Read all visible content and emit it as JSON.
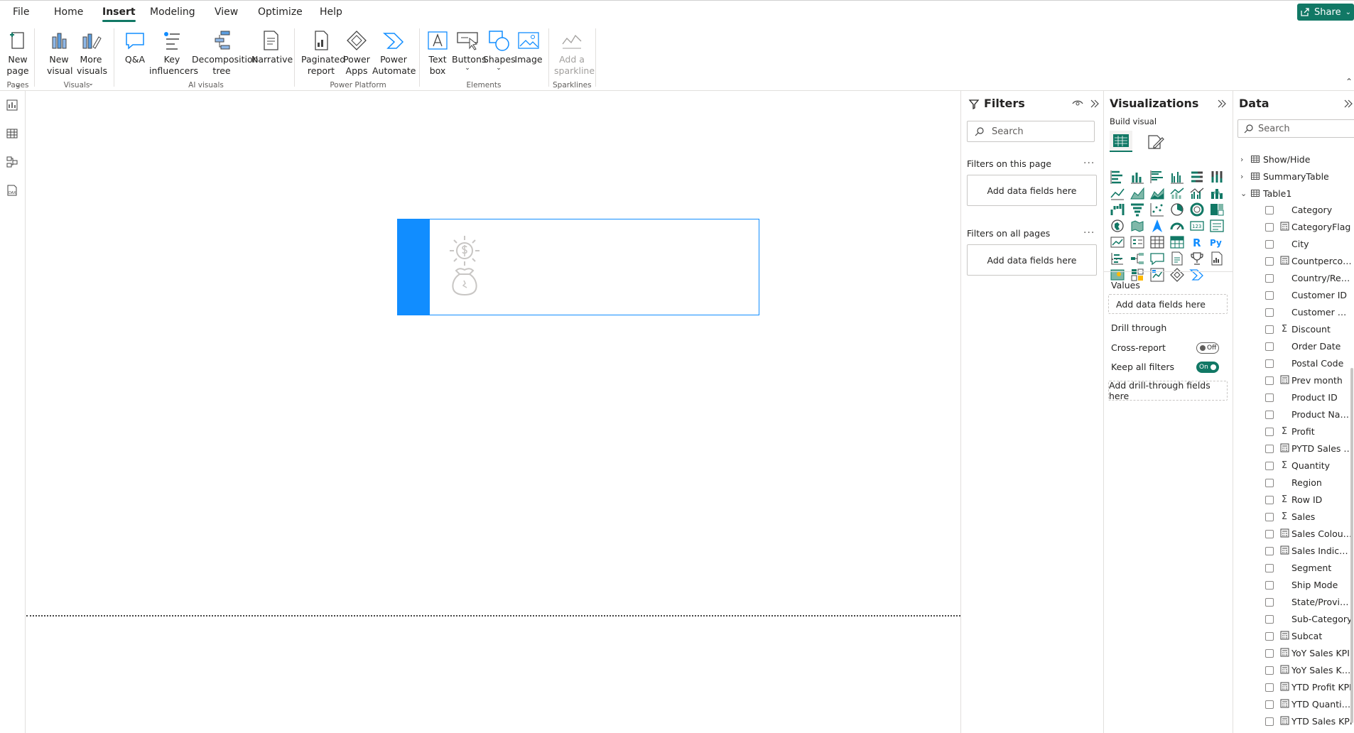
{
  "menu": {
    "file": "File",
    "home": "Home",
    "insert": "Insert",
    "modeling": "Modeling",
    "view": "View",
    "optimize": "Optimize",
    "help": "Help",
    "share": "Share"
  },
  "ribbon": {
    "new_page": [
      "New",
      "page"
    ],
    "new_visual": [
      "New",
      "visual"
    ],
    "more_visuals": [
      "More",
      "visuals"
    ],
    "qa": "Q&A",
    "key_influencers": [
      "Key",
      "influencers"
    ],
    "decomposition_tree": [
      "Decomposition",
      "tree"
    ],
    "narrative": "Narrative",
    "paginated_report": [
      "Paginated",
      "report"
    ],
    "power_apps": [
      "Power",
      "Apps"
    ],
    "power_automate": [
      "Power",
      "Automate"
    ],
    "text_box": [
      "Text",
      "box"
    ],
    "buttons": "Buttons",
    "shapes": "Shapes",
    "image": "Image",
    "add_sparkline": [
      "Add a",
      "sparkline"
    ],
    "groups": {
      "pages": "Pages",
      "visuals": "Visuals",
      "ai_visuals": "AI visuals",
      "power_platform": "Power Platform",
      "elements": "Elements",
      "sparklines": "Sparklines"
    }
  },
  "filters": {
    "title": "Filters",
    "search_placeholder": "Search",
    "on_this_page": "Filters on this page",
    "on_all_pages": "Filters on all pages",
    "add_fields": "Add data fields here",
    "more": "..."
  },
  "visualizations": {
    "title": "Visualizations",
    "build_visual": "Build visual",
    "values": "Values",
    "values_well": "Add data fields here",
    "drill_through": "Drill through",
    "cross_report": "Cross-report",
    "cross_report_state": "Off",
    "keep_all_filters": "Keep all filters",
    "keep_all_filters_state": "On",
    "drill_well": "Add drill-through fields here",
    "more": "...",
    "accent": "#117865"
  },
  "data": {
    "title": "Data",
    "search_placeholder": "Search",
    "tables": [
      "Show/Hide",
      "SummaryTable",
      "Table1"
    ],
    "fields": [
      {
        "name": "Category",
        "icon": ""
      },
      {
        "name": "CategoryFlag",
        "icon": "calc"
      },
      {
        "name": "City",
        "icon": ""
      },
      {
        "name": "Countpercount",
        "icon": "calc"
      },
      {
        "name": "Country/Region",
        "icon": ""
      },
      {
        "name": "Customer ID",
        "icon": ""
      },
      {
        "name": "Customer Na...",
        "icon": ""
      },
      {
        "name": "Discount",
        "icon": "sum"
      },
      {
        "name": "Order Date",
        "icon": ""
      },
      {
        "name": "Postal Code",
        "icon": ""
      },
      {
        "name": "Prev month",
        "icon": "calc"
      },
      {
        "name": "Product ID",
        "icon": ""
      },
      {
        "name": "Product Name",
        "icon": ""
      },
      {
        "name": "Profit",
        "icon": "sum"
      },
      {
        "name": "PYTD Sales KPI",
        "icon": "calc"
      },
      {
        "name": "Quantity",
        "icon": "sum"
      },
      {
        "name": "Region",
        "icon": ""
      },
      {
        "name": "Row ID",
        "icon": "sum"
      },
      {
        "name": "Sales",
        "icon": "sum"
      },
      {
        "name": "Sales Colour K...",
        "icon": "calc"
      },
      {
        "name": "Sales Indicato...",
        "icon": "calc"
      },
      {
        "name": "Segment",
        "icon": ""
      },
      {
        "name": "Ship Mode",
        "icon": ""
      },
      {
        "name": "State/Province",
        "icon": ""
      },
      {
        "name": "Sub-Category",
        "icon": ""
      },
      {
        "name": "Subcat",
        "icon": "calc"
      },
      {
        "name": "YoY Sales KPI",
        "icon": "calc"
      },
      {
        "name": "YoY Sales KPI ...",
        "icon": "calc"
      },
      {
        "name": "YTD Profit KPI",
        "icon": "calc"
      },
      {
        "name": "YTD Quantity ...",
        "icon": "calc"
      },
      {
        "name": "YTD Sales KPI",
        "icon": "calc"
      }
    ]
  },
  "canvas": {
    "accent": "#118dff"
  }
}
